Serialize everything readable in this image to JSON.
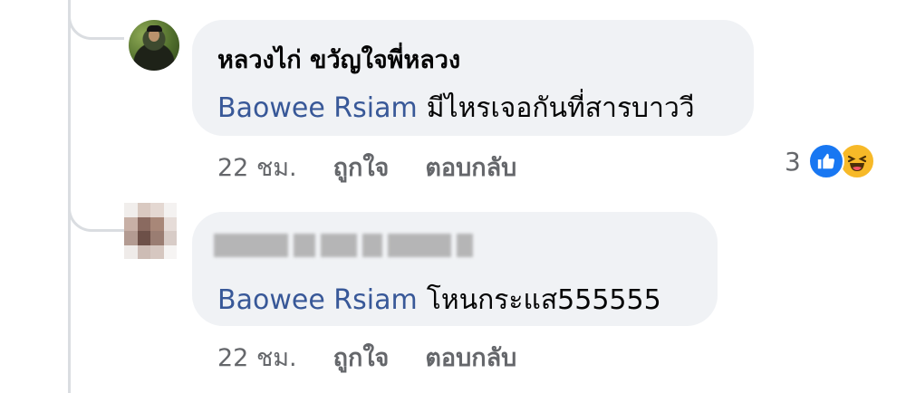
{
  "comments": [
    {
      "author": "หลวงไก่ ขวัญใจพี่หลวง",
      "mention": "Baowee Rsiam",
      "text": "มีไหรเจอกันที่สารบาววี",
      "time": "22 ชม.",
      "like_label": "ถูกใจ",
      "reply_label": "ตอบกลับ",
      "reaction_count": "3",
      "reactions": [
        "like-icon",
        "haha-icon"
      ]
    },
    {
      "author": "",
      "mention": "Baowee Rsiam",
      "text": "โหนกระแส555555",
      "time": "22 ชม.",
      "like_label": "ถูกใจ",
      "reply_label": "ตอบกลับ"
    }
  ],
  "colors": {
    "bubble": "#f0f2f5",
    "mention": "#385898",
    "meta": "#65676b",
    "like": "#1877f2",
    "haha": "#f7b928"
  }
}
